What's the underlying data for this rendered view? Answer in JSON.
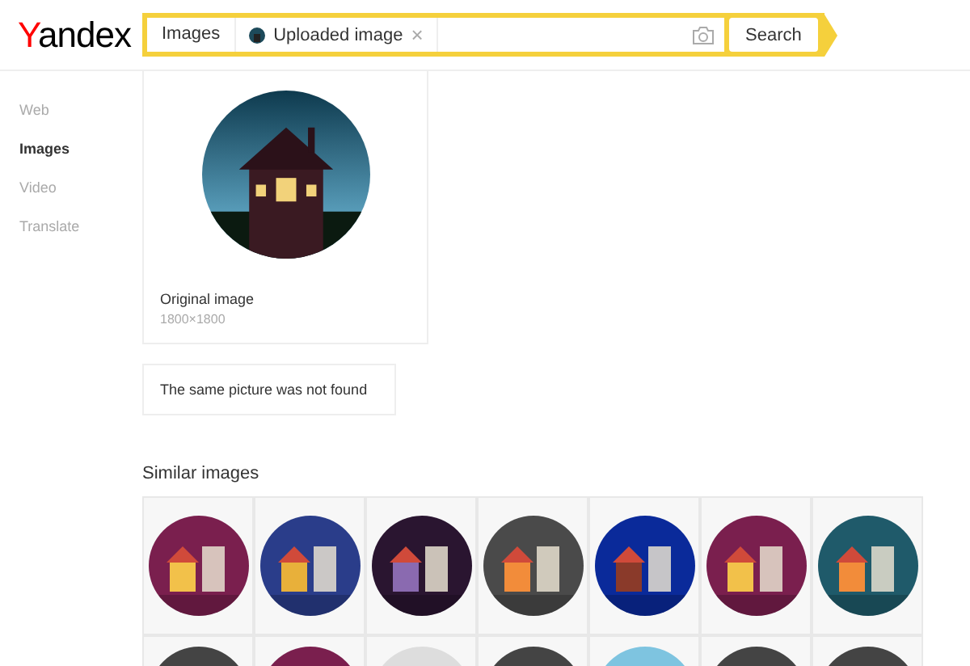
{
  "header": {
    "logo": "Yandex",
    "search": {
      "scope": "Images",
      "chip": {
        "label": "Uploaded image",
        "remove": "×"
      },
      "button": "Search"
    }
  },
  "sidebar": {
    "items": [
      {
        "label": "Web",
        "selected": false
      },
      {
        "label": "Images",
        "selected": true
      },
      {
        "label": "Video",
        "selected": false
      },
      {
        "label": "Translate",
        "selected": false
      }
    ]
  },
  "original": {
    "kind": "picture",
    "title": "Original image",
    "size": "1800×1800"
  },
  "notice": "The same picture was not found",
  "similar": {
    "title": "Similar images"
  }
}
